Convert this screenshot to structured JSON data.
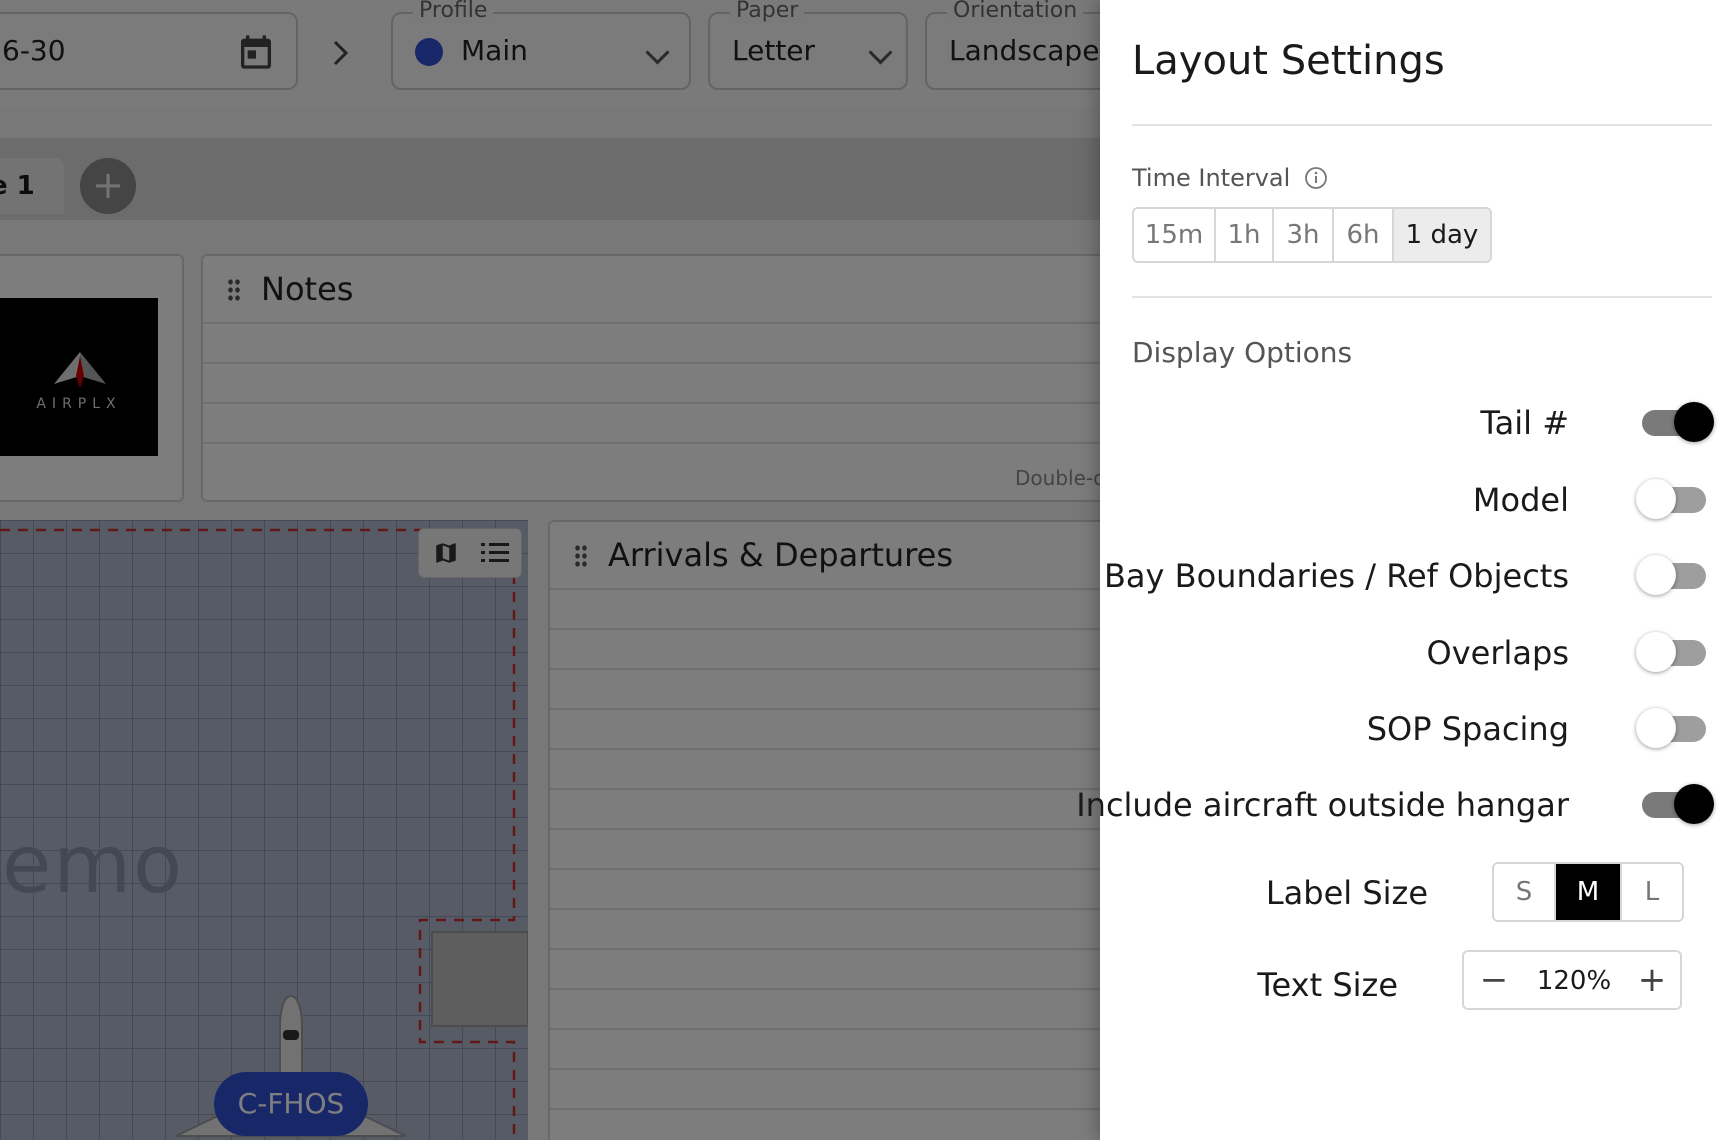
{
  "toolbar": {
    "date_fragment": "6-30",
    "profile": {
      "legend": "Profile",
      "value": "Main",
      "dot_color": "#2f4fd1"
    },
    "paper": {
      "legend": "Paper",
      "value": "Letter"
    },
    "orientation": {
      "legend": "Orientation",
      "value": "Landscape"
    }
  },
  "tabs": {
    "active_fragment": "e 1",
    "add_symbol": "+"
  },
  "panels": {
    "logo_text": "AIRPLX",
    "notes_title": "Notes",
    "notes_hint_fragment": "Double-c",
    "arrivals_title": "Arrivals & Departures"
  },
  "map": {
    "watermark_fragment": "emo",
    "aircraft_badge": "C-FHOS"
  },
  "drawer": {
    "title": "Layout Settings",
    "time_interval": {
      "label": "Time Interval",
      "options": [
        "15m",
        "1h",
        "3h",
        "6h",
        "1 day"
      ],
      "selected": "1 day"
    },
    "display_options": {
      "label": "Display Options",
      "toggles": [
        {
          "label": "Tail #",
          "on": true
        },
        {
          "label": "Model",
          "on": false
        },
        {
          "label": "Bay Boundaries / Ref Objects",
          "on": false
        },
        {
          "label": "Overlaps",
          "on": false
        },
        {
          "label": "SOP Spacing",
          "on": false
        },
        {
          "label": "Include aircraft outside hangar",
          "on": true
        }
      ]
    },
    "label_size": {
      "label": "Label Size",
      "options": [
        "S",
        "M",
        "L"
      ],
      "selected": "M"
    },
    "text_size": {
      "label": "Text Size",
      "value": "120%",
      "minus": "−",
      "plus": "+"
    }
  }
}
